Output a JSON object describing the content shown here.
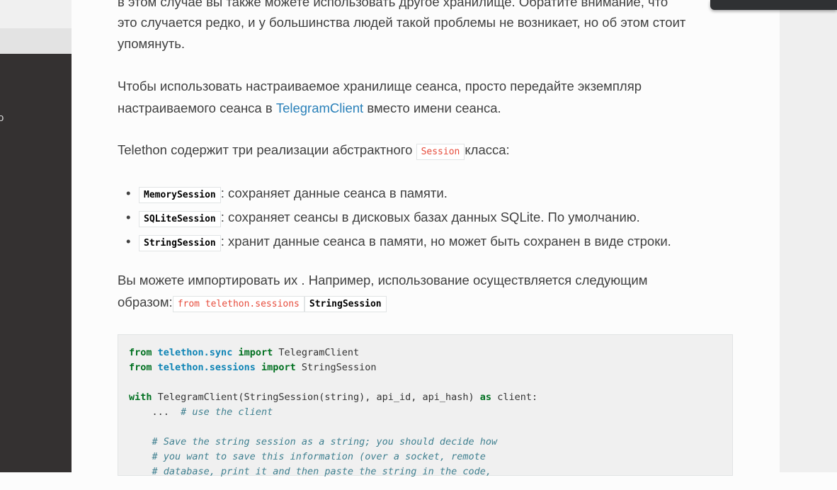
{
  "page": {
    "top_partial_line": "в этом случае вы также можете использовать другое хранилище. Обратите внимание, что",
    "para1_line2": "это случается редко, и у большинства людей такой проблемы не возникает, но об этом стоит",
    "para1_line3": "упомянуть.",
    "para2_text_a": "Чтобы использовать настраиваемое хранилище сеанса, просто передайте экземпляр",
    "para2_text_b": "настраиваемого сеанса в ",
    "para2_link": "TelegramClient",
    "para2_text_c": " вместо имени сеанса.",
    "para3_text_a": "Telethon содержит три реализации абстрактного ",
    "para3_code": "Session",
    "para3_text_b": "класса:",
    "bullets": [
      {
        "code": "MemorySession",
        "text": ": сохраняет данные сеанса в памяти."
      },
      {
        "code": "SQLiteSession",
        "text": ": сохраняет сеансы в дисковых базах данных SQLite. По умолчанию."
      },
      {
        "code": "StringSession",
        "text": ": хранит данные сеанса в памяти, но может быть сохранен в виде строки."
      }
    ],
    "para4_line1": "Вы можете импортировать их . Например, использование осуществляется следующим",
    "para4_line2_a": "образом:",
    "para4_code1": "from telethon.sessions",
    "para4_code2": "StringSession",
    "code": {
      "l1_kw1": "from",
      "l1_mod": "telethon.sync",
      "l1_kw2": "import",
      "l1_rest": " TelegramClient",
      "l2_kw1": "from",
      "l2_mod": "telethon.sessions",
      "l2_kw2": "import",
      "l2_rest": " StringSession",
      "l4_kw": "with",
      "l4_mid": " TelegramClient(StringSession(string), api_id, api_hash) ",
      "l4_kw2": "as",
      "l4_rest": " client:",
      "l5_dots": "    ...  ",
      "l5_comment": "# use the client",
      "l7_comment": "    # Save the string session as a string; you should decide how",
      "l8_comment": "    # you want to save this information (over a socket, remote",
      "l9_comment": "    # database, print it and then paste the string in the code,"
    }
  }
}
